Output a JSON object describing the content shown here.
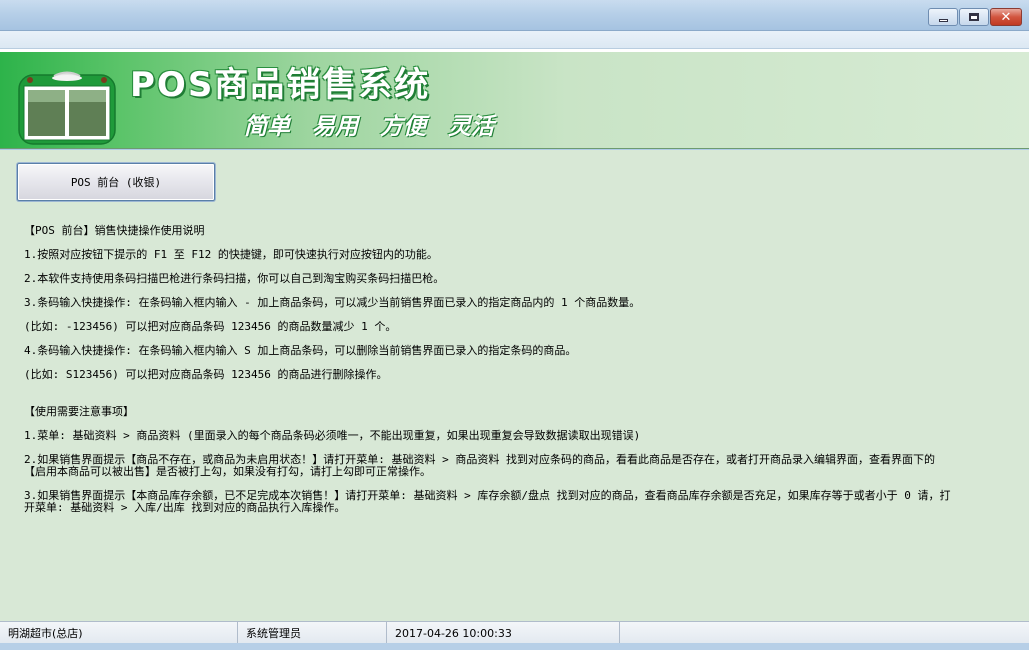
{
  "window": {
    "controls": [
      "minimize-icon",
      "maximize-icon",
      "close-icon"
    ],
    "close_glyph": "✕"
  },
  "banner": {
    "title": "POS商品销售系统",
    "slogan": "简单  易用  方便  灵活",
    "colors": {
      "green": "#2db34a",
      "light_green": "#d7ebd4",
      "title_shadow": "#1f7d35"
    }
  },
  "main": {
    "pos_button_label": "POS 前台 (收银)",
    "instructions_title": "【POS 前台】销售快捷操作使用说明",
    "instructions": [
      "1.按照对应按钮下提示的 F1 至 F12 的快捷键，即可快速执行对应按钮内的功能。",
      "2.本软件支持使用条码扫描巴枪进行条码扫描，你可以自己到淘宝购买条码扫描巴枪。",
      "3.条码输入快捷操作: 在条码输入框内输入 - 加上商品条码，可以减少当前销售界面已录入的指定商品内的 1 个商品数量。",
      " (比如: -123456) 可以把对应商品条码 123456 的商品数量减少 1 个。",
      "4.条码输入快捷操作: 在条码输入框内输入 S 加上商品条码，可以删除当前销售界面已录入的指定条码的商品。",
      " (比如: S123456) 可以把对应商品条码 123456 的商品进行删除操作。"
    ],
    "notes_title": "【使用需要注意事项】",
    "notes": [
      "1.菜单: 基础资料 > 商品资料 (里面录入的每个商品条码必须唯一，不能出现重复，如果出现重复会导致数据读取出现错误)",
      "2.如果销售界面提示【商品不存在，或商品为未启用状态！】请打开菜单: 基础资料 > 商品资料 找到对应条码的商品，看看此商品是否存在，或者打开商品录入编辑界面，查看界面下的【启用本商品可以被出售】是否被打上勾，如果没有打勾，请打上勾即可正常操作。",
      "3.如果销售界面提示【本商品库存余额，已不足完成本次销售！】请打开菜单: 基础资料 > 库存余额/盘点 找到对应的商品，查看商品库存余额是否充足，如果库存等于或者小于 0 请，打开菜单: 基础资料 > 入库/出库 找到对应的商品执行入库操作。"
    ]
  },
  "statusbar": {
    "store": "明湖超市(总店)",
    "user": "系统管理员",
    "datetime": "2017-04-26 10:00:33"
  }
}
